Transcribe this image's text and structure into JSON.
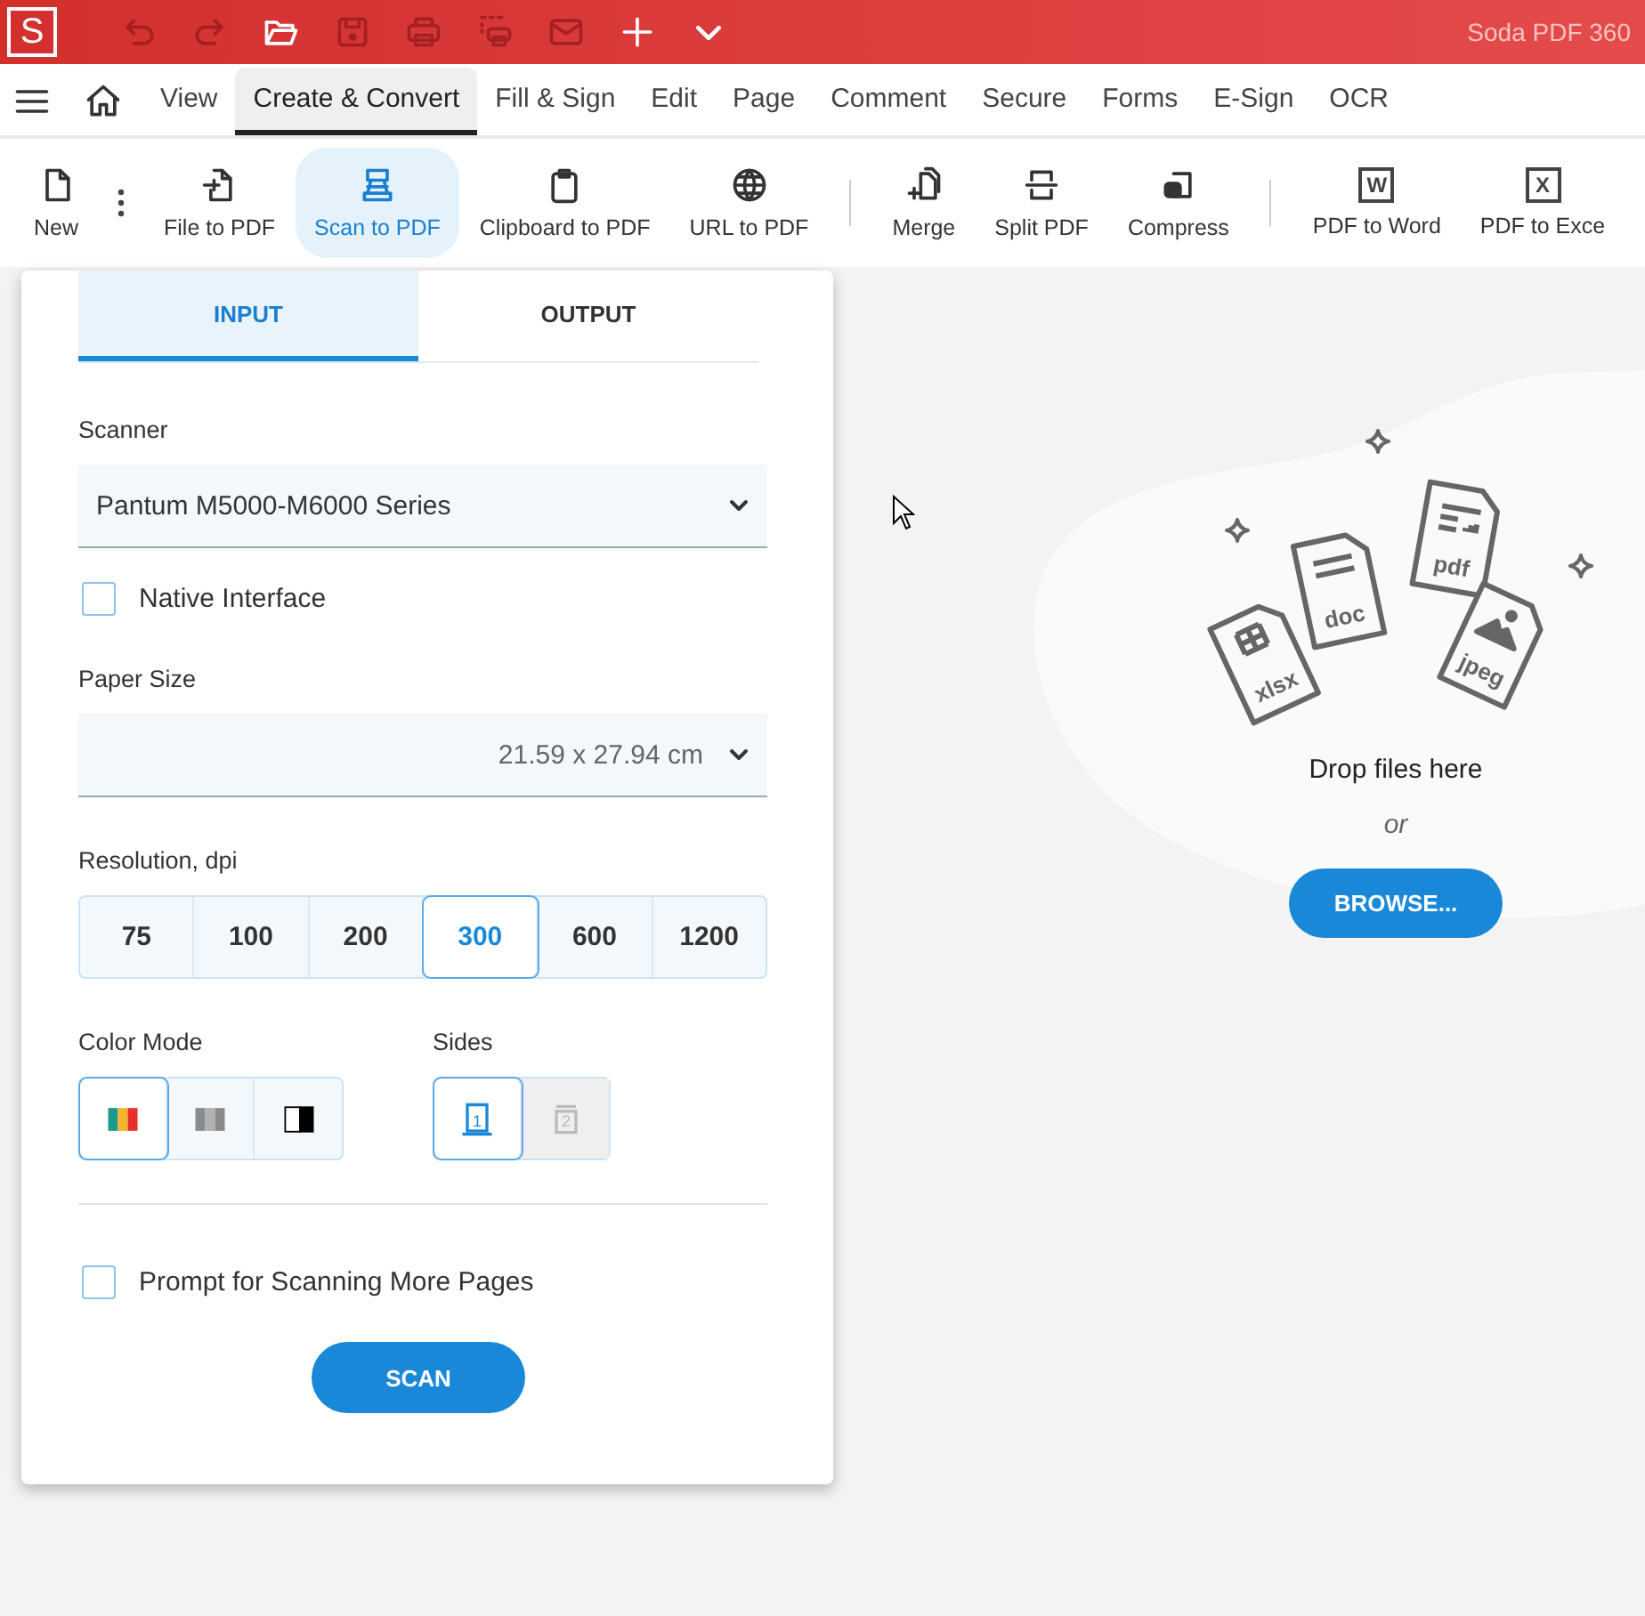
{
  "app": {
    "logo": "S",
    "title": "Soda PDF 360"
  },
  "quick_actions": [
    {
      "kind": "undo",
      "disabled": true
    },
    {
      "kind": "redo",
      "disabled": true
    },
    {
      "kind": "open",
      "disabled": false
    },
    {
      "kind": "save",
      "disabled": true
    },
    {
      "kind": "print",
      "disabled": true
    },
    {
      "kind": "print_range",
      "disabled": true
    },
    {
      "kind": "mail",
      "disabled": true
    },
    {
      "kind": "add",
      "disabled": false
    },
    {
      "kind": "chevron",
      "disabled": false
    }
  ],
  "menu_tabs": [
    {
      "label": "View",
      "selected": false
    },
    {
      "label": "Create & Convert",
      "selected": true
    },
    {
      "label": "Fill & Sign",
      "selected": false
    },
    {
      "label": "Edit",
      "selected": false
    },
    {
      "label": "Page",
      "selected": false
    },
    {
      "label": "Comment",
      "selected": false
    },
    {
      "label": "Secure",
      "selected": false
    },
    {
      "label": "Forms",
      "selected": false
    },
    {
      "label": "E-Sign",
      "selected": false
    },
    {
      "label": "OCR",
      "selected": false
    }
  ],
  "toolbar": [
    {
      "kind": "new",
      "label": "New",
      "selected": false
    },
    {
      "kind": "more"
    },
    {
      "kind": "file",
      "label": "File to PDF",
      "selected": false
    },
    {
      "kind": "scan",
      "label": "Scan to PDF",
      "selected": true
    },
    {
      "kind": "clipboard",
      "label": "Clipboard to PDF",
      "selected": false
    },
    {
      "kind": "globe",
      "label": "URL to PDF",
      "selected": false
    },
    {
      "kind": "separator"
    },
    {
      "kind": "merge",
      "label": "Merge",
      "selected": false
    },
    {
      "kind": "split",
      "label": "Split PDF",
      "selected": false
    },
    {
      "kind": "compress",
      "label": "Compress",
      "selected": false
    },
    {
      "kind": "separator"
    },
    {
      "kind": "letter",
      "letter": "W",
      "label": "PDF to Word",
      "selected": false
    },
    {
      "kind": "letter",
      "letter": "X",
      "label": "PDF to Exce",
      "selected": false
    }
  ],
  "panel": {
    "tabs": [
      {
        "label": "INPUT",
        "selected": true
      },
      {
        "label": "OUTPUT",
        "selected": false
      }
    ],
    "scanner": {
      "label": "Scanner",
      "value": "Pantum M5000-M6000 Series"
    },
    "native_interface": {
      "label": "Native Interface",
      "checked": false
    },
    "paper_size": {
      "label": "Paper Size",
      "value": "21.59 x 27.94 cm"
    },
    "resolution": {
      "label": "Resolution, dpi",
      "options": [
        {
          "label": "75",
          "selected": false
        },
        {
          "label": "100",
          "selected": false
        },
        {
          "label": "200",
          "selected": false
        },
        {
          "label": "300",
          "selected": true
        },
        {
          "label": "600",
          "selected": false
        },
        {
          "label": "1200",
          "selected": false
        }
      ]
    },
    "color_mode": {
      "label": "Color Mode",
      "options": [
        {
          "kind": "color",
          "selected": true
        },
        {
          "kind": "grayscale",
          "selected": false
        },
        {
          "kind": "black_white",
          "selected": false
        }
      ]
    },
    "sides": {
      "label": "Sides",
      "options": [
        {
          "kind": "single",
          "digit": "1",
          "selected": true,
          "disabled": false
        },
        {
          "kind": "double",
          "digit": "2",
          "selected": false,
          "disabled": true
        }
      ]
    },
    "prompt_more": {
      "label": "Prompt for Scanning More Pages",
      "checked": false
    },
    "scan_button": "SCAN"
  },
  "drop_zone": {
    "files": [
      {
        "kind": "xlsx",
        "label": "xlsx"
      },
      {
        "kind": "doc",
        "label": "doc"
      },
      {
        "kind": "pdf",
        "label": "pdf"
      },
      {
        "kind": "jpeg",
        "label": "jpeg"
      }
    ],
    "message": "Drop files here",
    "or": "or",
    "button": "BROWSE..."
  }
}
